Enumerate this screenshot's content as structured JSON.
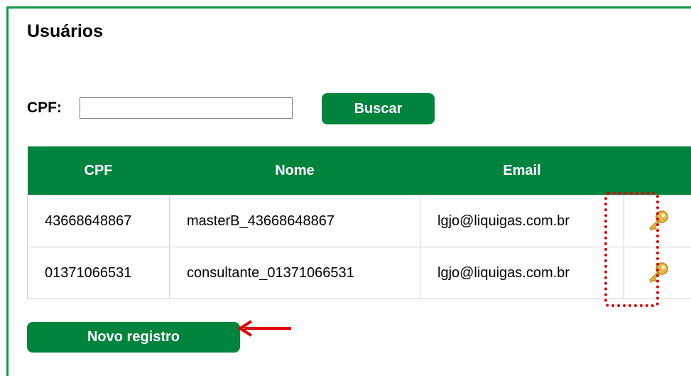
{
  "page": {
    "title": "Usuários"
  },
  "search": {
    "label": "CPF:",
    "value": "",
    "placeholder": "",
    "button_label": "Buscar"
  },
  "table": {
    "columns": [
      "CPF",
      "Nome",
      "Email",
      ""
    ],
    "rows": [
      {
        "cpf": "43668648867",
        "nome": "masterB_43668648867",
        "email": "lgjo@liquigas.com.br",
        "action_icon": "key-icon"
      },
      {
        "cpf": "01371066531",
        "nome": "consultante_01371066531",
        "email": "lgjo@liquigas.com.br",
        "action_icon": "key-icon"
      }
    ]
  },
  "actions": {
    "new_record_label": "Novo registro"
  },
  "colors": {
    "accent": "#00843d",
    "frame_border": "#0a9a45",
    "annotation": "#e00000",
    "key_icon": "#e8b84a"
  },
  "annotations": {
    "highlight": "dotted-red-box",
    "pointer": "red-arrow"
  }
}
